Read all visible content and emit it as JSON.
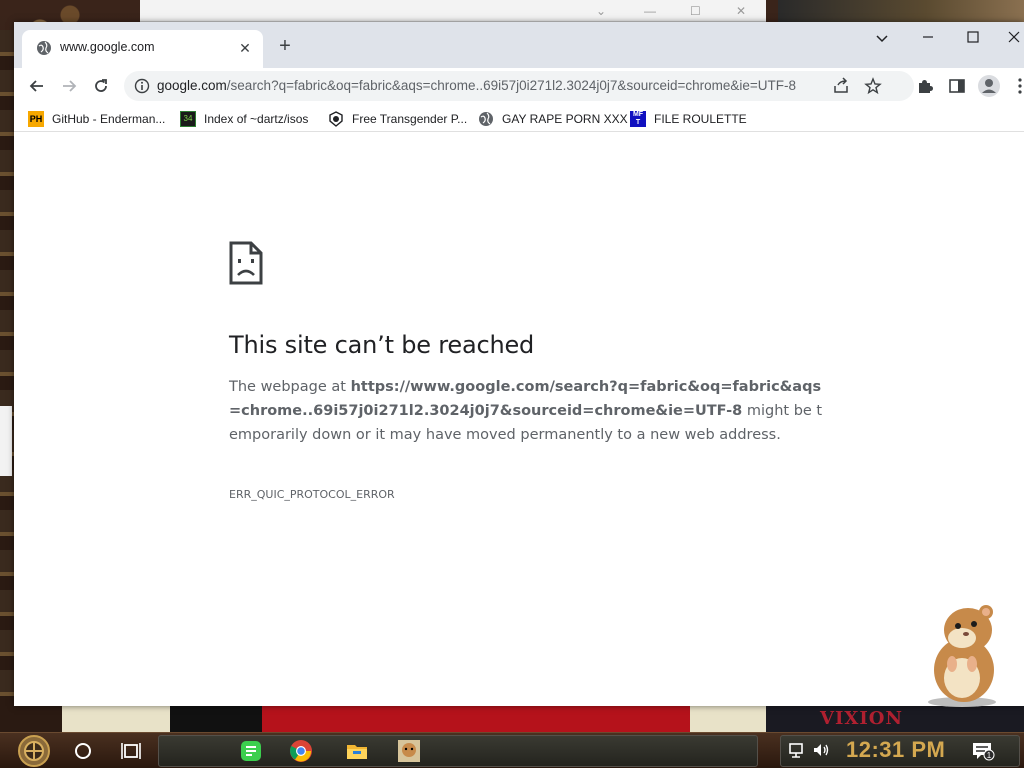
{
  "browser": {
    "tab": {
      "title": "www.google.com"
    },
    "address_bar": {
      "host": "google.com",
      "path": "/search?q=fabric&oq=fabric&aqs=chrome..69i57j0i271l2.3024j0j7&sourceid=chrome&ie=UTF-8"
    },
    "bookmarks": [
      {
        "label": "GitHub - Enderman...",
        "icon": "ph-icon"
      },
      {
        "label": "Index of ~dartz/isos",
        "icon": "blocks-icon"
      },
      {
        "label": "Free Transgender P...",
        "icon": "badge-icon"
      },
      {
        "label": "GAY RAPE PORN XXX",
        "icon": "globe-icon"
      },
      {
        "label": "FILE ROULETTE",
        "icon": "mft-icon"
      }
    ]
  },
  "error_page": {
    "title": "This site can’t be reached",
    "body_prefix": "The webpage at ",
    "body_url": "https://www.google.com/search?q=fabric&oq=fabric&aqs=chrome..69i57j0i271l2.3024j0j7&sourceid=chrome&ie=UTF-8",
    "body_suffix": " might be temporarily down or it may have moved permanently to a new web address.",
    "error_code": "ERR_QUIC_PROTOCOL_ERROR"
  },
  "taskbar": {
    "clock": "12:31 PM",
    "notification_count": "1"
  },
  "desktop": {
    "watermark": "VIXION"
  }
}
